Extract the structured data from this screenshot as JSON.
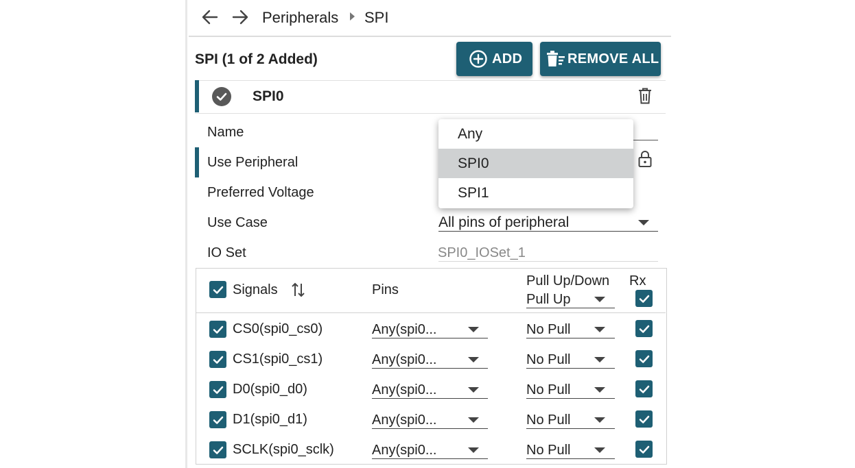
{
  "breadcrumb": {
    "back_icon": "arrow-left-icon",
    "forward_icon": "arrow-right-icon",
    "items": [
      "Peripherals",
      "SPI"
    ]
  },
  "section": {
    "title": "SPI (1 of 2 Added)",
    "add_label": "ADD",
    "remove_all_label": "REMOVE ALL"
  },
  "instance": {
    "name": "SPI0",
    "status_icon": "check-circle-icon",
    "delete_icon": "trash-icon"
  },
  "properties": {
    "name_label": "Name",
    "use_peripheral_label": "Use Peripheral",
    "preferred_voltage_label": "Preferred Voltage",
    "use_case_label": "Use Case",
    "use_case_value": "All pins of peripheral",
    "io_set_label": "IO Set",
    "io_set_value": "SPI0_IOSet_1",
    "lock_icon": "lock-icon"
  },
  "dropdown": {
    "options": [
      "Any",
      "SPI0",
      "SPI1"
    ],
    "selected": "SPI0"
  },
  "signals_table": {
    "headers": {
      "signals": "Signals",
      "pins": "Pins",
      "pull": "Pull Up/Down",
      "rx": "Rx"
    },
    "header_pull_value": "Pull Up",
    "rows": [
      {
        "signal": "CS0(spi0_cs0)",
        "pin": "Any(spi0...",
        "pull": "No Pull"
      },
      {
        "signal": "CS1(spi0_cs1)",
        "pin": "Any(spi0...",
        "pull": "No Pull"
      },
      {
        "signal": "D0(spi0_d0)",
        "pin": "Any(spi0...",
        "pull": "No Pull"
      },
      {
        "signal": "D1(spi0_d1)",
        "pin": "Any(spi0...",
        "pull": "No Pull"
      },
      {
        "signal": "SCLK(spi0_sclk)",
        "pin": "Any(spi0...",
        "pull": "No Pull"
      }
    ]
  },
  "colors": {
    "accent": "#1e5f74",
    "selected_option_bg": "#cfd1d2"
  }
}
